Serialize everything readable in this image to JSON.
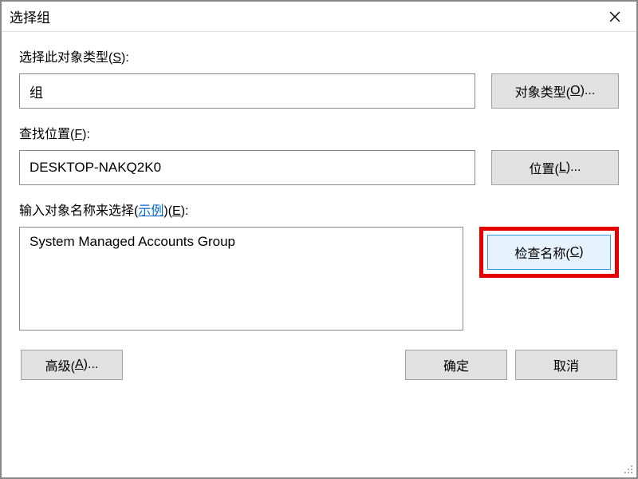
{
  "title": "选择组",
  "labels": {
    "object_type_pre": "选择此对象类型(",
    "object_type_accel": "S",
    "object_type_post": "):",
    "location_pre": "查找位置(",
    "location_accel": "F",
    "location_post": "):",
    "names_pre": "输入对象名称来选择(",
    "names_link": "示例",
    "names_mid": ")(",
    "names_accel": "E",
    "names_post": "):"
  },
  "fields": {
    "object_type_value": "组",
    "location_value": "DESKTOP-NAKQ2K0",
    "names_value": "System Managed Accounts Group"
  },
  "buttons": {
    "object_types_pre": "对象类型(",
    "object_types_accel": "O",
    "object_types_post": ")...",
    "locations_pre": "位置(",
    "locations_accel": "L",
    "locations_post": ")...",
    "check_names_pre": "检查名称(",
    "check_names_accel": "C",
    "check_names_post": ")",
    "advanced_pre": "高级(",
    "advanced_accel": "A",
    "advanced_post": ")...",
    "ok": "确定",
    "cancel": "取消"
  }
}
